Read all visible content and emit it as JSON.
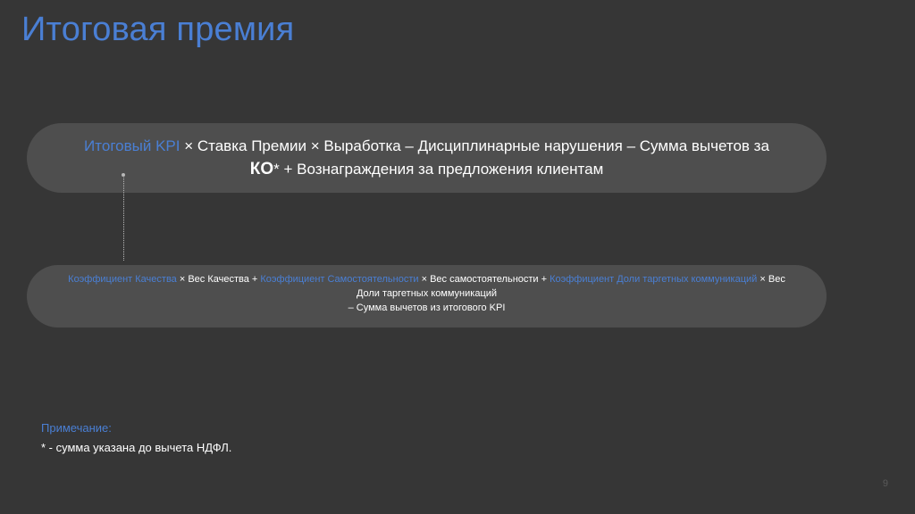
{
  "slide": {
    "title": "Итоговая премия",
    "page_number": "9"
  },
  "formula_main": {
    "part1_blue": "Итоговый KPI",
    "part2": " × Ставка Премии × Выработка – Дисциплинарные нарушения – Сумма вычетов за",
    "part3_bold": "КО",
    "part4": "* + Вознаграждения за предложения клиентам"
  },
  "formula_kpi": {
    "coef_quality": "Коэффициент Качества",
    "weight_quality": " × Вес Качества + ",
    "coef_independence": "Коэффициент Самостоятельности",
    "weight_independence": " × Вес самостоятельности + ",
    "coef_target": "Коэффициент Доли таргетных коммуникаций",
    "weight_target_1": " × Вес",
    "weight_target_2": "Доли таргетных коммуникаций",
    "deduction": "– Сумма вычетов из итогового KPI"
  },
  "note": {
    "heading": "Примечание:",
    "text": "* - сумма указана до вычета НДФЛ."
  },
  "colors": {
    "background": "#363636",
    "pill": "#4e4e4e",
    "accent": "#4a7fd4",
    "text": "#ffffff"
  }
}
